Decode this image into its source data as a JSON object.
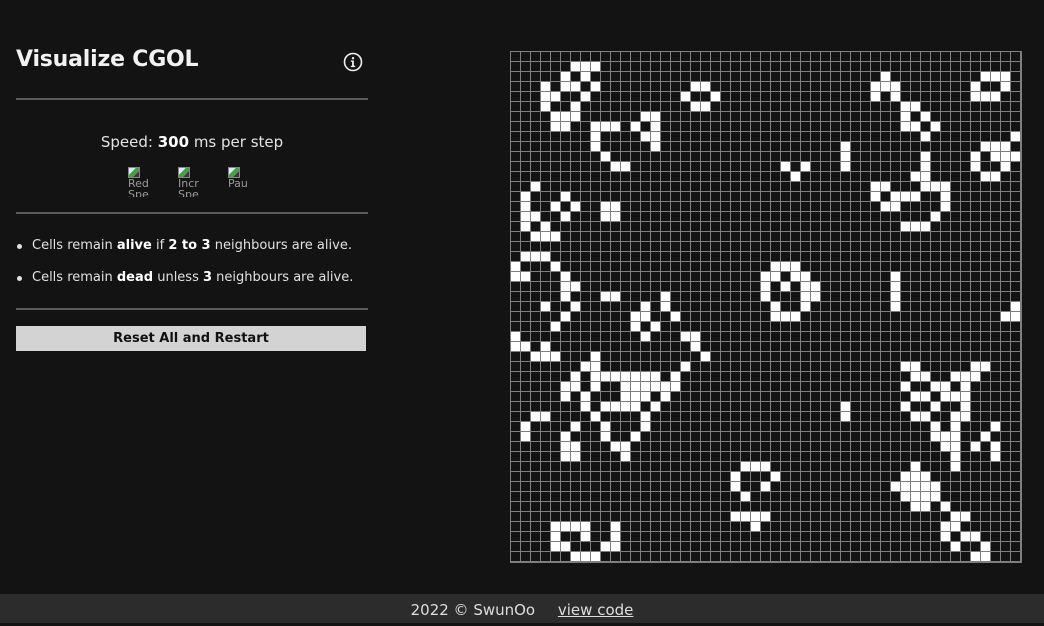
{
  "app": {
    "title": "Visualize CGOL",
    "info_icon": "info-circle-icon"
  },
  "speed": {
    "prefix": "Speed:",
    "value": "300",
    "suffix": "ms per step"
  },
  "controls": [
    {
      "name": "reduce-speed-button",
      "alt": "Red",
      "alt_cut": "Spe"
    },
    {
      "name": "increase-speed-button",
      "alt": "Incr",
      "alt_cut": "Spe"
    },
    {
      "name": "pause-button",
      "alt": "Pau",
      "alt_cut": ""
    }
  ],
  "rules": [
    {
      "t1": "Cells remain ",
      "b1": "alive",
      "t2": " if ",
      "b2": "2 to 3",
      "t3": " neighbours are alive."
    },
    {
      "t1": "Cells remain ",
      "b1": "dead",
      "t2": " unless ",
      "b2": "3",
      "t3": " neighbours are alive."
    }
  ],
  "reset_label": "Reset All and Restart",
  "grid": {
    "rows": 51,
    "cols": 51,
    "cell_color": "#ffffff",
    "dead_color": "#131313",
    "line_color": "#7f7f7f",
    "alive": [
      [
        1,
        6
      ],
      [
        1,
        7
      ],
      [
        1,
        8
      ],
      [
        2,
        5
      ],
      [
        2,
        7
      ],
      [
        2,
        37
      ],
      [
        2,
        47
      ],
      [
        2,
        48
      ],
      [
        2,
        49
      ],
      [
        3,
        3
      ],
      [
        3,
        5
      ],
      [
        3,
        6
      ],
      [
        3,
        8
      ],
      [
        3,
        18
      ],
      [
        3,
        19
      ],
      [
        3,
        36
      ],
      [
        3,
        37
      ],
      [
        3,
        38
      ],
      [
        3,
        46
      ],
      [
        3,
        49
      ],
      [
        4,
        3
      ],
      [
        4,
        4
      ],
      [
        4,
        7
      ],
      [
        4,
        17
      ],
      [
        4,
        20
      ],
      [
        4,
        36
      ],
      [
        4,
        38
      ],
      [
        4,
        46
      ],
      [
        4,
        47
      ],
      [
        4,
        48
      ],
      [
        5,
        3
      ],
      [
        5,
        6
      ],
      [
        5,
        18
      ],
      [
        5,
        19
      ],
      [
        5,
        39
      ],
      [
        5,
        40
      ],
      [
        6,
        4
      ],
      [
        6,
        5
      ],
      [
        6,
        6
      ],
      [
        6,
        13
      ],
      [
        6,
        14
      ],
      [
        6,
        39
      ],
      [
        6,
        41
      ],
      [
        7,
        4
      ],
      [
        7,
        5
      ],
      [
        7,
        8
      ],
      [
        7,
        9
      ],
      [
        7,
        10
      ],
      [
        7,
        12
      ],
      [
        7,
        14
      ],
      [
        7,
        39
      ],
      [
        7,
        40
      ],
      [
        7,
        42
      ],
      [
        8,
        8
      ],
      [
        8,
        13
      ],
      [
        8,
        14
      ],
      [
        8,
        41
      ],
      [
        8,
        50
      ],
      [
        9,
        8
      ],
      [
        9,
        14
      ],
      [
        9,
        33
      ],
      [
        9,
        47
      ],
      [
        9,
        48
      ],
      [
        9,
        49
      ],
      [
        10,
        9
      ],
      [
        10,
        33
      ],
      [
        10,
        41
      ],
      [
        10,
        46
      ],
      [
        10,
        48
      ],
      [
        10,
        49
      ],
      [
        10,
        50
      ],
      [
        11,
        10
      ],
      [
        11,
        11
      ],
      [
        11,
        27
      ],
      [
        11,
        29
      ],
      [
        11,
        33
      ],
      [
        11,
        41
      ],
      [
        11,
        46
      ],
      [
        11,
        49
      ],
      [
        12,
        28
      ],
      [
        12,
        40
      ],
      [
        12,
        41
      ],
      [
        12,
        47
      ],
      [
        12,
        48
      ],
      [
        13,
        2
      ],
      [
        13,
        36
      ],
      [
        13,
        37
      ],
      [
        13,
        41
      ],
      [
        13,
        42
      ],
      [
        13,
        43
      ],
      [
        14,
        1
      ],
      [
        14,
        5
      ],
      [
        14,
        36
      ],
      [
        14,
        38
      ],
      [
        14,
        39
      ],
      [
        14,
        40
      ],
      [
        14,
        43
      ],
      [
        15,
        1
      ],
      [
        15,
        4
      ],
      [
        15,
        6
      ],
      [
        15,
        9
      ],
      [
        15,
        10
      ],
      [
        15,
        37
      ],
      [
        15,
        38
      ],
      [
        15,
        43
      ],
      [
        16,
        1
      ],
      [
        16,
        2
      ],
      [
        16,
        5
      ],
      [
        16,
        9
      ],
      [
        16,
        10
      ],
      [
        16,
        42
      ],
      [
        17,
        1
      ],
      [
        17,
        3
      ],
      [
        17,
        39
      ],
      [
        17,
        40
      ],
      [
        17,
        41
      ],
      [
        18,
        2
      ],
      [
        18,
        3
      ],
      [
        18,
        4
      ],
      [
        20,
        1
      ],
      [
        20,
        2
      ],
      [
        20,
        3
      ],
      [
        21,
        0
      ],
      [
        21,
        4
      ],
      [
        21,
        26
      ],
      [
        21,
        27
      ],
      [
        21,
        28
      ],
      [
        22,
        0
      ],
      [
        22,
        1
      ],
      [
        22,
        5
      ],
      [
        22,
        25
      ],
      [
        22,
        26
      ],
      [
        22,
        28
      ],
      [
        22,
        29
      ],
      [
        22,
        38
      ],
      [
        23,
        5
      ],
      [
        23,
        6
      ],
      [
        23,
        25
      ],
      [
        23,
        27
      ],
      [
        23,
        29
      ],
      [
        23,
        30
      ],
      [
        23,
        38
      ],
      [
        24,
        5
      ],
      [
        24,
        9
      ],
      [
        24,
        10
      ],
      [
        24,
        15
      ],
      [
        24,
        25
      ],
      [
        24,
        29
      ],
      [
        24,
        30
      ],
      [
        24,
        38
      ],
      [
        25,
        3
      ],
      [
        25,
        6
      ],
      [
        25,
        13
      ],
      [
        25,
        15
      ],
      [
        25,
        26
      ],
      [
        25,
        29
      ],
      [
        25,
        38
      ],
      [
        25,
        50
      ],
      [
        26,
        5
      ],
      [
        26,
        12
      ],
      [
        26,
        13
      ],
      [
        26,
        16
      ],
      [
        26,
        26
      ],
      [
        26,
        27
      ],
      [
        26,
        28
      ],
      [
        26,
        49
      ],
      [
        26,
        50
      ],
      [
        27,
        4
      ],
      [
        27,
        12
      ],
      [
        27,
        14
      ],
      [
        28,
        0
      ],
      [
        28,
        13
      ],
      [
        28,
        17
      ],
      [
        28,
        18
      ],
      [
        29,
        0
      ],
      [
        29,
        1
      ],
      [
        29,
        3
      ],
      [
        29,
        18
      ],
      [
        30,
        2
      ],
      [
        30,
        3
      ],
      [
        30,
        4
      ],
      [
        30,
        8
      ],
      [
        30,
        19
      ],
      [
        31,
        7
      ],
      [
        31,
        8
      ],
      [
        31,
        17
      ],
      [
        31,
        39
      ],
      [
        31,
        40
      ],
      [
        31,
        46
      ],
      [
        31,
        47
      ],
      [
        32,
        6
      ],
      [
        32,
        8
      ],
      [
        32,
        9
      ],
      [
        32,
        10
      ],
      [
        32,
        11
      ],
      [
        32,
        12
      ],
      [
        32,
        13
      ],
      [
        32,
        14
      ],
      [
        32,
        16
      ],
      [
        32,
        40
      ],
      [
        32,
        41
      ],
      [
        32,
        44
      ],
      [
        32,
        45
      ],
      [
        32,
        46
      ],
      [
        33,
        5
      ],
      [
        33,
        6
      ],
      [
        33,
        8
      ],
      [
        33,
        11
      ],
      [
        33,
        12
      ],
      [
        33,
        13
      ],
      [
        33,
        14
      ],
      [
        33,
        15
      ],
      [
        33,
        16
      ],
      [
        33,
        39
      ],
      [
        33,
        42
      ],
      [
        33,
        43
      ],
      [
        33,
        45
      ],
      [
        34,
        5
      ],
      [
        34,
        7
      ],
      [
        34,
        11
      ],
      [
        34,
        12
      ],
      [
        34,
        13
      ],
      [
        34,
        15
      ],
      [
        34,
        40
      ],
      [
        34,
        41
      ],
      [
        34,
        43
      ],
      [
        34,
        44
      ],
      [
        34,
        45
      ],
      [
        35,
        7
      ],
      [
        35,
        9
      ],
      [
        35,
        10
      ],
      [
        35,
        11
      ],
      [
        35,
        12
      ],
      [
        35,
        14
      ],
      [
        35,
        33
      ],
      [
        35,
        39
      ],
      [
        35,
        42
      ],
      [
        35,
        45
      ],
      [
        36,
        2
      ],
      [
        36,
        3
      ],
      [
        36,
        8
      ],
      [
        36,
        13
      ],
      [
        36,
        33
      ],
      [
        36,
        40
      ],
      [
        36,
        41
      ],
      [
        36,
        44
      ],
      [
        36,
        45
      ],
      [
        37,
        1
      ],
      [
        37,
        6
      ],
      [
        37,
        9
      ],
      [
        37,
        13
      ],
      [
        37,
        42
      ],
      [
        37,
        44
      ],
      [
        37,
        48
      ],
      [
        38,
        1
      ],
      [
        38,
        5
      ],
      [
        38,
        9
      ],
      [
        38,
        12
      ],
      [
        38,
        42
      ],
      [
        38,
        43
      ],
      [
        38,
        44
      ],
      [
        38,
        47
      ],
      [
        39,
        5
      ],
      [
        39,
        6
      ],
      [
        39,
        10
      ],
      [
        39,
        11
      ],
      [
        39,
        43
      ],
      [
        39,
        44
      ],
      [
        39,
        46
      ],
      [
        39,
        48
      ],
      [
        40,
        5
      ],
      [
        40,
        6
      ],
      [
        40,
        11
      ],
      [
        40,
        44
      ],
      [
        40,
        48
      ],
      [
        41,
        23
      ],
      [
        41,
        24
      ],
      [
        41,
        25
      ],
      [
        41,
        40
      ],
      [
        41,
        44
      ],
      [
        42,
        22
      ],
      [
        42,
        26
      ],
      [
        42,
        39
      ],
      [
        42,
        40
      ],
      [
        42,
        41
      ],
      [
        43,
        22
      ],
      [
        43,
        25
      ],
      [
        43,
        38
      ],
      [
        43,
        39
      ],
      [
        43,
        40
      ],
      [
        43,
        41
      ],
      [
        43,
        42
      ],
      [
        44,
        23
      ],
      [
        44,
        39
      ],
      [
        44,
        40
      ],
      [
        44,
        41
      ],
      [
        44,
        42
      ],
      [
        45,
        40
      ],
      [
        45,
        41
      ],
      [
        45,
        43
      ],
      [
        46,
        22
      ],
      [
        46,
        23
      ],
      [
        46,
        24
      ],
      [
        46,
        25
      ],
      [
        46,
        44
      ],
      [
        46,
        45
      ],
      [
        47,
        4
      ],
      [
        47,
        5
      ],
      [
        47,
        6
      ],
      [
        47,
        7
      ],
      [
        47,
        10
      ],
      [
        47,
        24
      ],
      [
        47,
        43
      ],
      [
        47,
        44
      ],
      [
        48,
        4
      ],
      [
        48,
        7
      ],
      [
        48,
        10
      ],
      [
        48,
        43
      ],
      [
        48,
        45
      ],
      [
        48,
        46
      ],
      [
        49,
        4
      ],
      [
        49,
        5
      ],
      [
        49,
        9
      ],
      [
        49,
        10
      ],
      [
        49,
        44
      ],
      [
        49,
        47
      ],
      [
        50,
        6
      ],
      [
        50,
        7
      ],
      [
        50,
        8
      ],
      [
        50,
        46
      ],
      [
        50,
        47
      ]
    ]
  },
  "footer": {
    "copyright": "2022 © SwunOo",
    "link_label": "view code"
  }
}
